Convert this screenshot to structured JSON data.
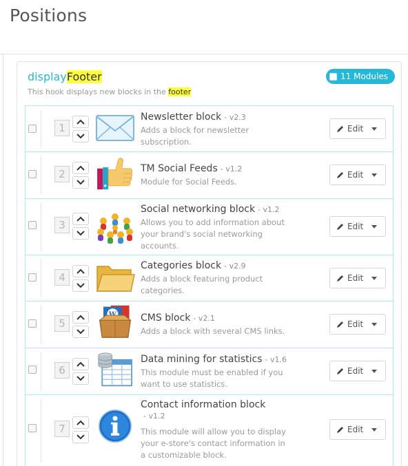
{
  "page": {
    "title": "Positions"
  },
  "hook": {
    "name_prefix": "display",
    "name_highlight": "Footer",
    "modules_badge": "11 Modules",
    "description_prefix": "This hook displays new blocks in the ",
    "description_highlight": "footer"
  },
  "modules": [
    {
      "position": "1",
      "name": "Newsletter block",
      "version": "- v2.3",
      "description": "Adds a block for newsletter subscription.",
      "icon": "envelope-icon",
      "edit_label": "Edit"
    },
    {
      "position": "2",
      "name": "TM Social Feeds",
      "version": "- v1.2",
      "description": "Module for Social Feeds.",
      "icon": "thumbs-up-icon",
      "edit_label": "Edit"
    },
    {
      "position": "3",
      "name": "Social networking block",
      "version": "- v1.2",
      "description": "Allows you to add information about your brand's social networking accounts.",
      "icon": "people-network-icon",
      "edit_label": "Edit"
    },
    {
      "position": "4",
      "name": "Categories block",
      "version": "- v2.9",
      "description": "Adds a block featuring product categories.",
      "icon": "folder-icon",
      "edit_label": "Edit"
    },
    {
      "position": "5",
      "name": "CMS block",
      "version": "- v2.1",
      "description": "Adds a block with several CMS links.",
      "icon": "wordpress-box-icon",
      "edit_label": "Edit"
    },
    {
      "position": "6",
      "name": "Data mining for statistics",
      "version": "- v1.6",
      "description": "This module must be enabled if you want to use statistics.",
      "icon": "database-table-icon",
      "edit_label": "Edit"
    },
    {
      "position": "7",
      "name": "Contact information block",
      "version": "- v1.2",
      "description": "This module will allow you to display your e-store's contact information in a customizable block.",
      "icon": "info-icon",
      "edit_label": "Edit"
    }
  ]
}
